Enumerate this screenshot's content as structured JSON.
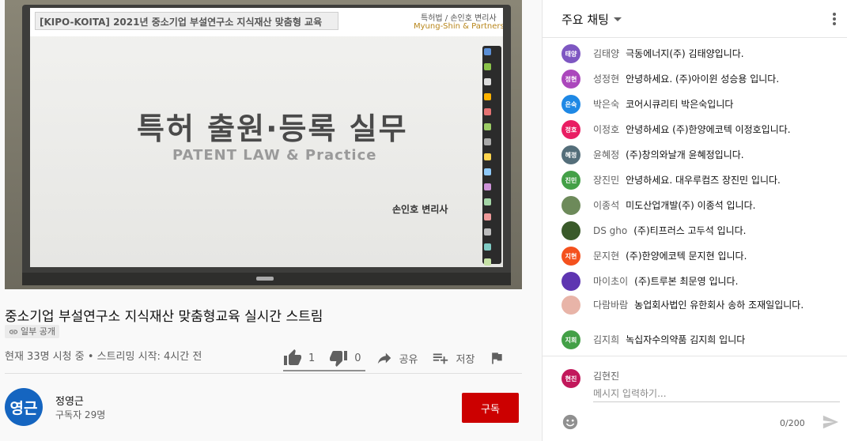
{
  "slide": {
    "header": "[KIPO-KOITA] 2021년 중소기업 부설연구소 지식재산 맞춤형 교육",
    "header_right_1": "특허법 / 손인호 변리사",
    "header_right_2": "Myung-Shin & Partners",
    "title": "특허 출원·등록 실무",
    "subtitle": "PATENT LAW & Practice",
    "author": "손인호 변리사"
  },
  "video": {
    "title": "중소기업 부설연구소 지식재산 맞춤형교육 실시간 스트림",
    "visibility": "일부 공개",
    "meta": "현재 33명 시청 중 • 스트리밍 시작: 4시간 전",
    "likes": "1",
    "dislikes": "0",
    "share_label": "공유",
    "save_label": "저장"
  },
  "channel": {
    "avatar_text": "영근",
    "name": "정영근",
    "subscribers": "구독자 29명",
    "subscribe_label": "구독"
  },
  "chat": {
    "title": "주요 채팅",
    "messages": [
      {
        "initials": "태양",
        "color": "#7e57c2",
        "name": "김태양",
        "text": "극동에너지(주) 김태양입니다."
      },
      {
        "initials": "정현",
        "color": "#ab47bc",
        "name": "성정현",
        "text": "안녕하세요. (주)아이윈 성승용 입니다."
      },
      {
        "initials": "은숙",
        "color": "#1e88e5",
        "name": "박은숙",
        "text": "코어시큐리티 박은숙입니다"
      },
      {
        "initials": "정호",
        "color": "#e91e63",
        "name": "이정호",
        "text": "안녕하세요 (주)한양에코텍 이정호입니다."
      },
      {
        "initials": "혜정",
        "color": "#546e7a",
        "name": "윤혜정",
        "text": "(주)창의와날개 윤혜정입니다."
      },
      {
        "initials": "진민",
        "color": "#43a047",
        "name": "장진민",
        "text": "안녕하세요. 대우루컴즈 장진민 입니다."
      },
      {
        "initials": "",
        "color": "#6d8a5a",
        "name": "이종석",
        "text": "미도산업개발(주) 이종석 입니다."
      },
      {
        "initials": "",
        "color": "#3a5a2a",
        "name": "DS gho",
        "text": "(주)티프러스 고두석 입니다."
      },
      {
        "initials": "지현",
        "color": "#f4511e",
        "name": "문지현",
        "text": "(주)한양에코텍 문지현 입니다."
      },
      {
        "initials": "",
        "color": "#5e35b1",
        "name": "마이초이",
        "text": "(주)트루본 최문영 입니다."
      },
      {
        "initials": "",
        "color": "#e8b4a8",
        "name": "다람바람",
        "text": "농업회사법인 유한회사 송하 조재일입니다."
      },
      {
        "initials": "지희",
        "color": "#43a047",
        "name": "김지희",
        "text": "녹십자수의약품 김지희 입니다"
      }
    ],
    "me": {
      "initials": "현진",
      "name": "김현진"
    },
    "input_placeholder": "메시지 입력하기...",
    "counter": "0/200"
  }
}
